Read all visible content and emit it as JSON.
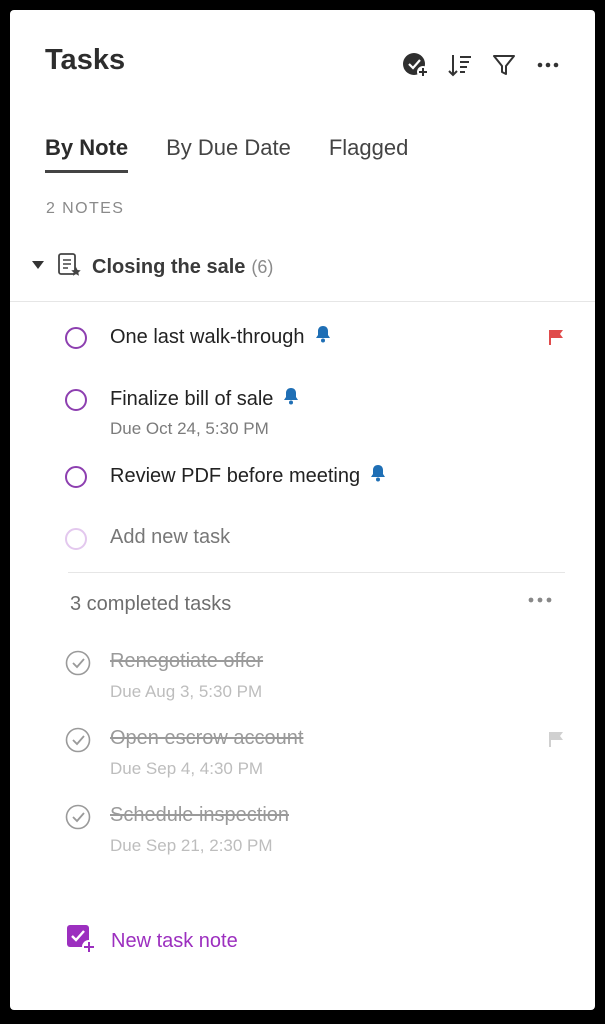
{
  "header": {
    "title": "Tasks"
  },
  "toolbar": {
    "icons": [
      "task-check-add-icon",
      "sort-icon",
      "filter-icon",
      "more-icon"
    ]
  },
  "tabs": [
    {
      "label": "By Note",
      "active": true
    },
    {
      "label": "By Due Date",
      "active": false
    },
    {
      "label": "Flagged",
      "active": false
    }
  ],
  "notes_count_label": "2 NOTES",
  "group": {
    "title": "Closing the sale",
    "count": "(6)"
  },
  "tasks": [
    {
      "title": "One last walk-through",
      "reminder": true,
      "flagged": true,
      "due": ""
    },
    {
      "title": "Finalize bill of sale",
      "reminder": true,
      "flagged": false,
      "due": "Due Oct 24, 5:30 PM"
    },
    {
      "title": "Review PDF before meeting",
      "reminder": true,
      "flagged": false,
      "due": ""
    }
  ],
  "add_task_placeholder": "Add new task",
  "completed": {
    "header": "3 completed tasks",
    "items": [
      {
        "title": "Renegotiate offer",
        "due": "Due Aug 3, 5:30 PM",
        "flagged": false
      },
      {
        "title": "Open escrow account",
        "due": "Due Sep 4, 4:30 PM",
        "flagged": true
      },
      {
        "title": "Schedule inspection",
        "due": "Due Sep 21, 2:30 PM",
        "flagged": false
      }
    ]
  },
  "new_task_note_label": "New task note",
  "colors": {
    "accent": "#9c2fbf",
    "circle": "#8d3fb0",
    "reminder": "#1f6fb5",
    "flag": "#e04b4b"
  }
}
